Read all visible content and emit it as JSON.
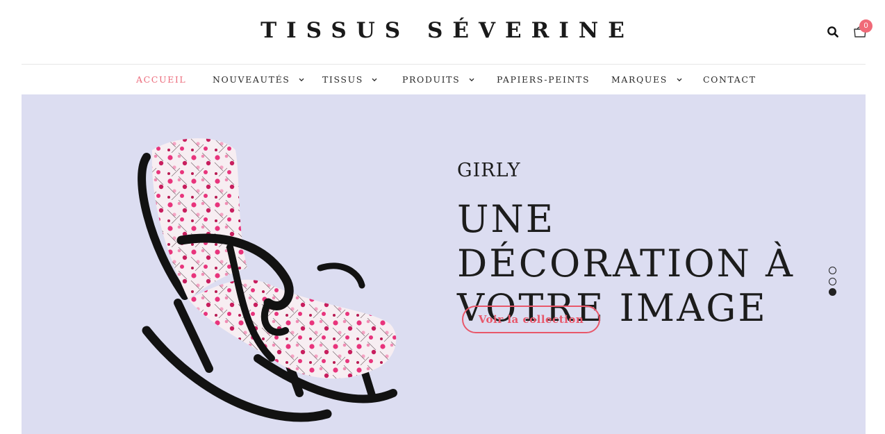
{
  "header": {
    "logo": "TISSUS SÉVERINE",
    "cart_count": "0",
    "accent_color": "#f06a78"
  },
  "nav": {
    "items": [
      {
        "label": "ACCUEIL",
        "active": true,
        "dropdown": false
      },
      {
        "label": "NOUVEAUTÉS",
        "active": false,
        "dropdown": true
      },
      {
        "label": "TISSUS",
        "active": false,
        "dropdown": true
      },
      {
        "label": "PRODUITS",
        "active": false,
        "dropdown": true
      },
      {
        "label": "PAPIERS-PEINTS",
        "active": false,
        "dropdown": false
      },
      {
        "label": "MARQUES",
        "active": false,
        "dropdown": true
      },
      {
        "label": "CONTACT",
        "active": false,
        "dropdown": false
      }
    ]
  },
  "hero": {
    "background_color": "#dcddf1",
    "subtitle": "GIRLY",
    "headline": "UNE DÉCORATION À VOTRE IMAGE",
    "cta_label": "Voir la collection",
    "slides_total": 3,
    "active_slide": 3
  },
  "icons": {
    "search": "search-icon",
    "cart": "shopping-bag-icon",
    "chevron": "chevron-down-icon"
  }
}
